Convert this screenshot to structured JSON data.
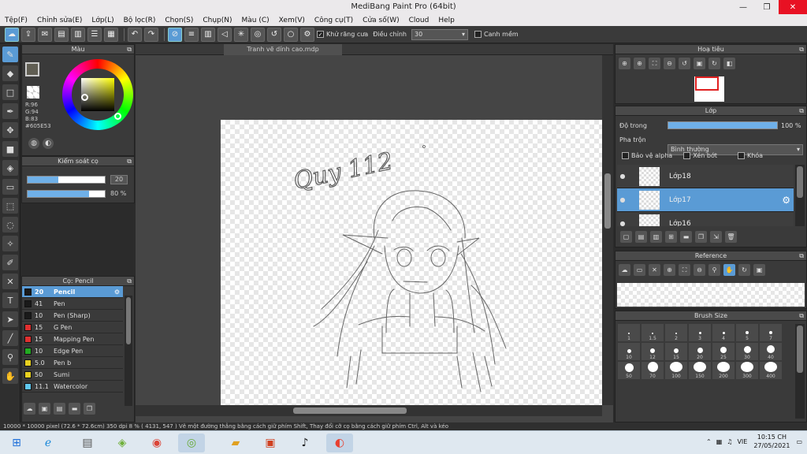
{
  "window": {
    "title": "MediBang Paint Pro (64bit)",
    "minimize": "—",
    "maximize": "❐",
    "close": "✕"
  },
  "menu": [
    "Tệp(F)",
    "Chỉnh sửa(E)",
    "Lớp(L)",
    "Bộ lọc(R)",
    "Chọn(S)",
    "Chụp(N)",
    "Màu (C)",
    "Xem(V)",
    "Công cụ(T)",
    "Cửa số(W)",
    "Cloud",
    "Help"
  ],
  "toolbar": {
    "antialias_label": "Khử răng cưa",
    "adjust_label": "Điều chỉnh",
    "adjust_value": "30",
    "margin_label": "Canh mềm"
  },
  "color_panel": {
    "title": "Màu",
    "r": "R:96",
    "g": "G:94",
    "b": "B:83",
    "hex": "#605E53",
    "fg_color": "#605E53"
  },
  "brush_control": {
    "title": "Kiểm soát cọ",
    "size_value": "20",
    "size_fraction": 0.4,
    "opacity_value": "80 %",
    "opacity_fraction": 0.8
  },
  "brush_list": {
    "title": "Cọ: Pencil",
    "items": [
      {
        "size": "20",
        "name": "Pencil",
        "color": "#1a1a1a"
      },
      {
        "size": "41",
        "name": "Pen",
        "color": "#1a1a1a"
      },
      {
        "size": "10",
        "name": "Pen (Sharp)",
        "color": "#1a1a1a"
      },
      {
        "size": "15",
        "name": "G Pen",
        "color": "#e03030"
      },
      {
        "size": "15",
        "name": "Mapping Pen",
        "color": "#e03030"
      },
      {
        "size": "10",
        "name": "Edge Pen",
        "color": "#22aa22"
      },
      {
        "size": "5.0",
        "name": "Pen b",
        "color": "#e8d020"
      },
      {
        "size": "50",
        "name": "Sumi",
        "color": "#e8d020"
      },
      {
        "size": "11.1",
        "name": "Watercolor",
        "color": "#60c8f0"
      }
    ]
  },
  "canvas": {
    "doc_tab": "Tranh vẽ dính cao.mdp",
    "signature_text": "Quy 112"
  },
  "navigator": {
    "title": "Hoạ tiêu"
  },
  "layers": {
    "title": "Lớp",
    "opacity_label": "Độ trong",
    "opacity_value": "100 %",
    "opacity_fraction": 1.0,
    "blend_label": "Pha trộn",
    "blend_value": "Bình thường",
    "protect_alpha": "Bảo vệ alpha",
    "clipping": "Xén bớt",
    "lock": "Khóa",
    "items": [
      {
        "name": "Lớp18",
        "selected": false
      },
      {
        "name": "Lớp17",
        "selected": true
      },
      {
        "name": "Lớp16",
        "selected": false
      }
    ]
  },
  "reference": {
    "title": "Reference"
  },
  "brush_size": {
    "title": "Brush Size",
    "sizes": [
      "1",
      "1.5",
      "2",
      "3",
      "4",
      "5",
      "7",
      "10",
      "12",
      "15",
      "20",
      "25",
      "30",
      "40",
      "50",
      "70",
      "100",
      "150",
      "200",
      "300",
      "400"
    ]
  },
  "statusbar": {
    "text": "10000 * 10000 pixel   (72.6 * 72.6cm)   350 dpi   8 %   ( 4131, 547 )   Vẽ một đường thẳng bằng cách giữ phím Shift, Thay đổi cỡ cọ bằng cách giữ phím Ctrl, Alt và kéo"
  },
  "taskbar": {
    "lang": "VIE",
    "time": "10:15 CH",
    "date": "27/05/2021"
  }
}
